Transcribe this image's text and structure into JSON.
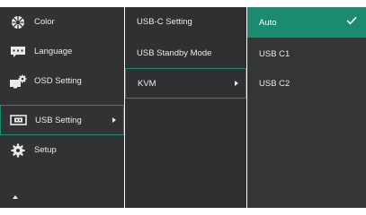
{
  "menu": {
    "main_items": [
      {
        "label": "Color",
        "icon": "color-wheel-icon"
      },
      {
        "label": "Language",
        "icon": "speech-bubble-icon"
      },
      {
        "label": "OSD Setting",
        "icon": "monitor-gear-icon"
      },
      {
        "label": "USB Setting",
        "icon": "usb-icon",
        "selected": true
      },
      {
        "label": "Setup",
        "icon": "gear-icon"
      }
    ],
    "sub_items": [
      {
        "label": "USB-C Setting"
      },
      {
        "label": "USB Standby Mode"
      },
      {
        "label": "KVM",
        "selected": true
      }
    ],
    "options": [
      {
        "label": "Auto",
        "active": true
      },
      {
        "label": "USB C1"
      },
      {
        "label": "USB C2"
      }
    ]
  },
  "colors": {
    "accent": "#1c8a6f",
    "panel": "#333536",
    "text": "#e9eaea"
  }
}
